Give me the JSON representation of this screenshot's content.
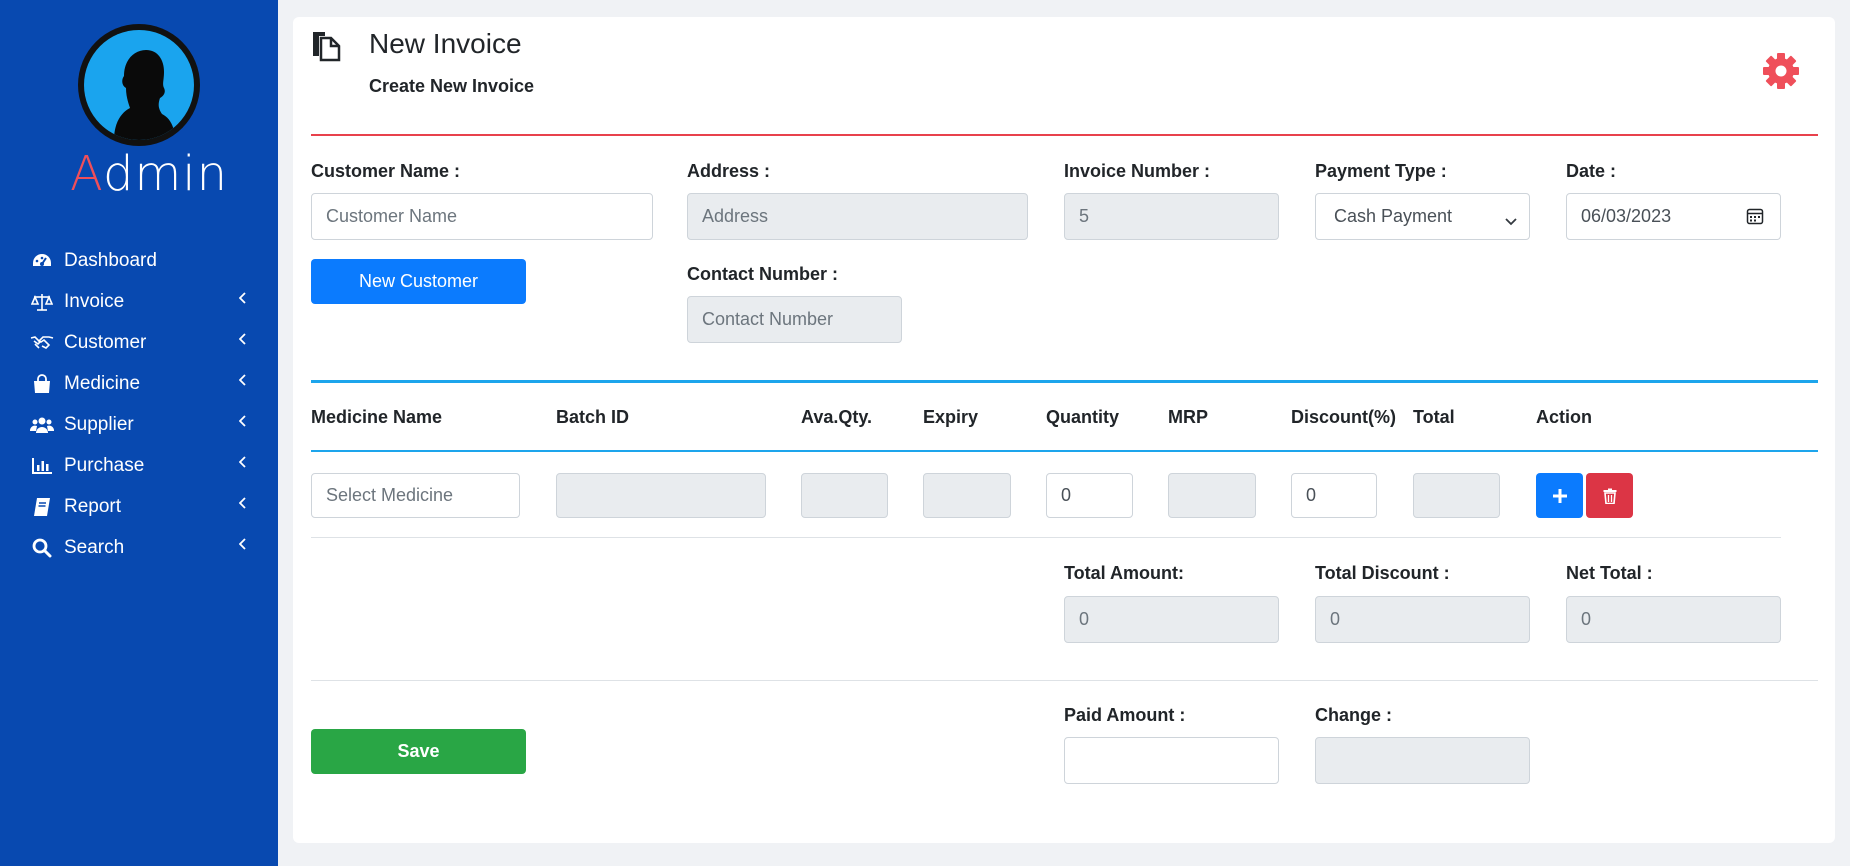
{
  "sidebar": {
    "brand_first": "A",
    "brand_rest": "dmin",
    "items": [
      {
        "label": "Dashboard",
        "icon": "dashboard-icon",
        "has_chevron": false
      },
      {
        "label": "Invoice",
        "icon": "balance-scale-icon",
        "has_chevron": true
      },
      {
        "label": "Customer",
        "icon": "handshake-icon",
        "has_chevron": true
      },
      {
        "label": "Medicine",
        "icon": "shopping-bag-icon",
        "has_chevron": true
      },
      {
        "label": "Supplier",
        "icon": "users-icon",
        "has_chevron": true
      },
      {
        "label": "Purchase",
        "icon": "bar-chart-icon",
        "has_chevron": true
      },
      {
        "label": "Report",
        "icon": "book-icon",
        "has_chevron": true
      },
      {
        "label": "Search",
        "icon": "search-icon",
        "has_chevron": true
      }
    ]
  },
  "header": {
    "title": "New Invoice",
    "subtitle": "Create New Invoice"
  },
  "form": {
    "customer_name_label": "Customer Name :",
    "customer_name_placeholder": "Customer Name",
    "new_customer_button": "New Customer",
    "address_label": "Address :",
    "address_placeholder": "Address",
    "contact_label": "Contact Number :",
    "contact_placeholder": "Contact Number",
    "invoice_number_label": "Invoice Number :",
    "invoice_number_value": "5",
    "payment_type_label": "Payment Type :",
    "payment_type_value": "Cash Payment",
    "date_label": "Date :",
    "date_value": "06/03/2023"
  },
  "table": {
    "headers": [
      "Medicine Name",
      "Batch ID",
      "Ava.Qty.",
      "Expiry",
      "Quantity",
      "MRP",
      "Discount(%)",
      "Total",
      "Action"
    ],
    "row": {
      "medicine_placeholder": "Select Medicine",
      "quantity": "0",
      "discount": "0"
    }
  },
  "totals": {
    "total_amount_label": "Total Amount:",
    "total_amount_value": "0",
    "total_discount_label": "Total Discount :",
    "total_discount_value": "0",
    "net_total_label": "Net Total :",
    "net_total_value": "0",
    "paid_amount_label": "Paid Amount :",
    "paid_amount_value": "",
    "change_label": "Change :",
    "change_value": "",
    "save_button": "Save"
  },
  "colors": {
    "sidebar_bg": "#0849b0",
    "accent_red": "#ef4f5a",
    "primary_blue": "#0b7bfe",
    "success_green": "#29a645",
    "danger_red": "#dc3545",
    "divider_blue": "#1da5ec"
  }
}
